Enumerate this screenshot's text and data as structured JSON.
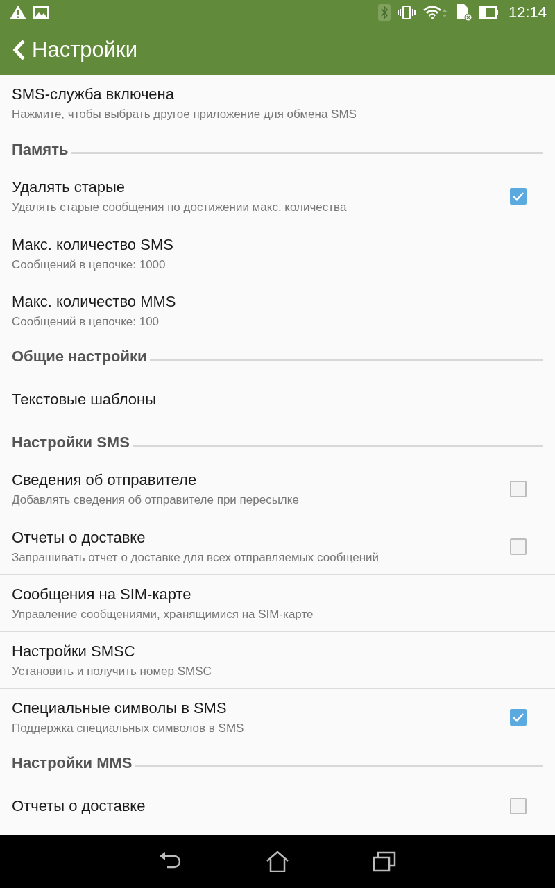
{
  "status_bar": {
    "time": "12:14"
  },
  "header": {
    "title": "Настройки"
  },
  "items": [
    {
      "kind": "pref",
      "title": "SMS-служба включена",
      "summary": "Нажмите, чтобы выбрать другое приложение для обмена SMS"
    },
    {
      "kind": "section",
      "title": "Память"
    },
    {
      "kind": "pref",
      "title": "Удалять старые",
      "summary": "Удалять старые сообщения по достижении макс. количества",
      "checked": true
    },
    {
      "kind": "pref",
      "title": "Макс. количество SMS",
      "summary": "Сообщений в цепочке: 1000"
    },
    {
      "kind": "pref",
      "title": "Макс. количество MMS",
      "summary": "Сообщений в цепочке: 100"
    },
    {
      "kind": "section",
      "title": "Общие настройки"
    },
    {
      "kind": "pref",
      "title": "Текстовые шаблоны"
    },
    {
      "kind": "section",
      "title": "Настройки SMS"
    },
    {
      "kind": "pref",
      "title": "Сведения об отправителе",
      "summary": "Добавлять сведения об отправителе при пересылке",
      "checked": false
    },
    {
      "kind": "pref",
      "title": "Отчеты о доставке",
      "summary": "Запрашивать отчет о доставке для всех отправляемых сообщений",
      "checked": false
    },
    {
      "kind": "pref",
      "title": "Сообщения на SIM-карте",
      "summary": "Управление сообщениями, хранящимися на SIM-карте"
    },
    {
      "kind": "pref",
      "title": "Настройки SMSC",
      "summary": "Установить и получить номер SMSC"
    },
    {
      "kind": "pref",
      "title": "Специальные символы в SMS",
      "summary": "Поддержка специальных символов в SMS",
      "checked": true
    },
    {
      "kind": "section",
      "title": "Настройки MMS"
    },
    {
      "kind": "pref",
      "title": "Отчеты о доставке",
      "checked": false
    }
  ]
}
